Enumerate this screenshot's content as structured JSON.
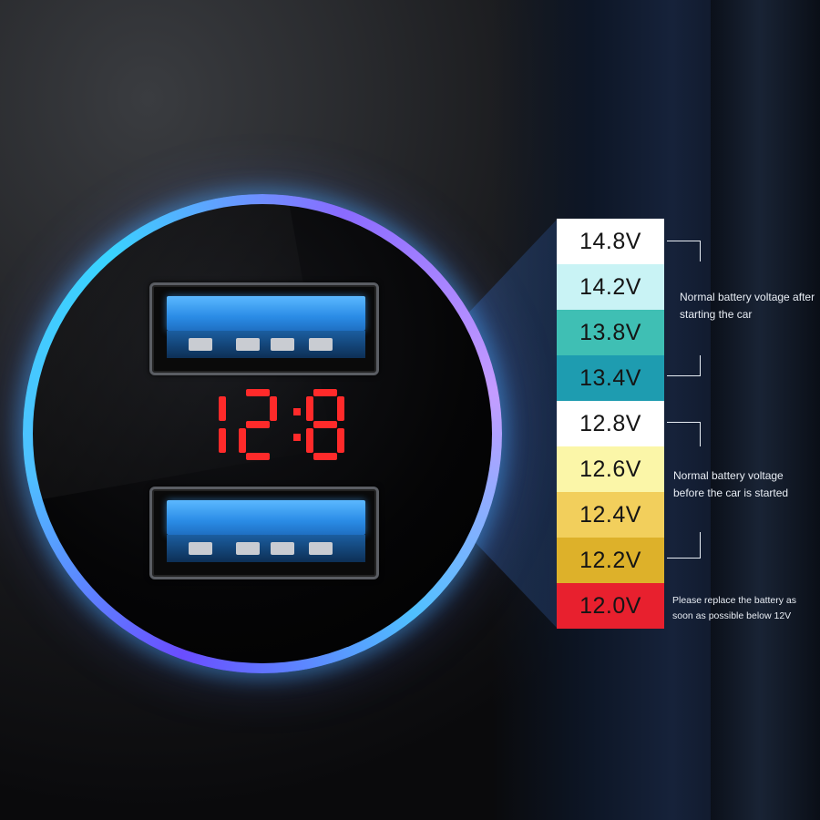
{
  "display": {
    "reading": "12:8",
    "color": "#ff2a2a"
  },
  "scale": [
    {
      "label": "14.8V",
      "color": "#ffffff"
    },
    {
      "label": "14.2V",
      "color": "#c9f3f5"
    },
    {
      "label": "13.8V",
      "color": "#3fbfb4"
    },
    {
      "label": "13.4V",
      "color": "#1e9cb0"
    },
    {
      "label": "12.8V",
      "color": "#ffffff"
    },
    {
      "label": "12.6V",
      "color": "#fbf6a8"
    },
    {
      "label": "12.4V",
      "color": "#f2cf5c"
    },
    {
      "label": "12.2V",
      "color": "#ddb12a"
    },
    {
      "label": "12.0V",
      "color": "#e8202e"
    }
  ],
  "notes": {
    "after_start": "Normal battery voltage after starting the car",
    "before_start": "Normal battery voltage before the car is started",
    "replace": "Please replace the battery as soon as possible below 12V"
  },
  "colors": {
    "ring_glow": "#4fc0ff",
    "usb_blue": "#2a8ce6",
    "note_text": "#e8edf4"
  }
}
